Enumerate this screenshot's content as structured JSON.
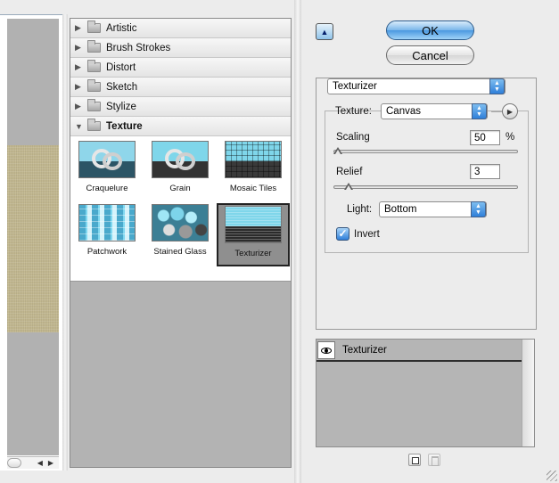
{
  "gallery": {
    "categories": [
      {
        "label": "Artistic",
        "open": false
      },
      {
        "label": "Brush Strokes",
        "open": false
      },
      {
        "label": "Distort",
        "open": false
      },
      {
        "label": "Sketch",
        "open": false
      },
      {
        "label": "Stylize",
        "open": false
      },
      {
        "label": "Texture",
        "open": true
      }
    ],
    "thumbnails": [
      {
        "label": "Craquelure",
        "icon": "craquelure-thumbnail",
        "selected": false
      },
      {
        "label": "Grain",
        "icon": "grain-thumbnail",
        "selected": false
      },
      {
        "label": "Mosaic Tiles",
        "icon": "mosaic-tiles-thumbnail",
        "selected": false
      },
      {
        "label": "Patchwork",
        "icon": "patchwork-thumbnail",
        "selected": false
      },
      {
        "label": "Stained Glass",
        "icon": "stained-glass-thumbnail",
        "selected": false
      },
      {
        "label": "Texturizer",
        "icon": "texturizer-thumbnail",
        "selected": true
      }
    ]
  },
  "buttons": {
    "ok": "OK",
    "cancel": "Cancel"
  },
  "settings": {
    "filter": "Texturizer",
    "texture_label": "Texture:",
    "texture_value": "Canvas",
    "scaling_label": "Scaling",
    "scaling_value": "50",
    "scaling_unit": "%",
    "scaling_fraction": 0.0,
    "relief_label": "Relief",
    "relief_value": "3",
    "relief_fraction": 0.06,
    "light_label": "Light:",
    "light_value": "Bottom",
    "invert_label": "Invert",
    "invert_checked": true
  },
  "layers": {
    "items": [
      {
        "name": "Texturizer",
        "visible": true
      }
    ]
  },
  "colors": {
    "accent": "#4a98e0",
    "preview_texture": "#c2b890"
  }
}
